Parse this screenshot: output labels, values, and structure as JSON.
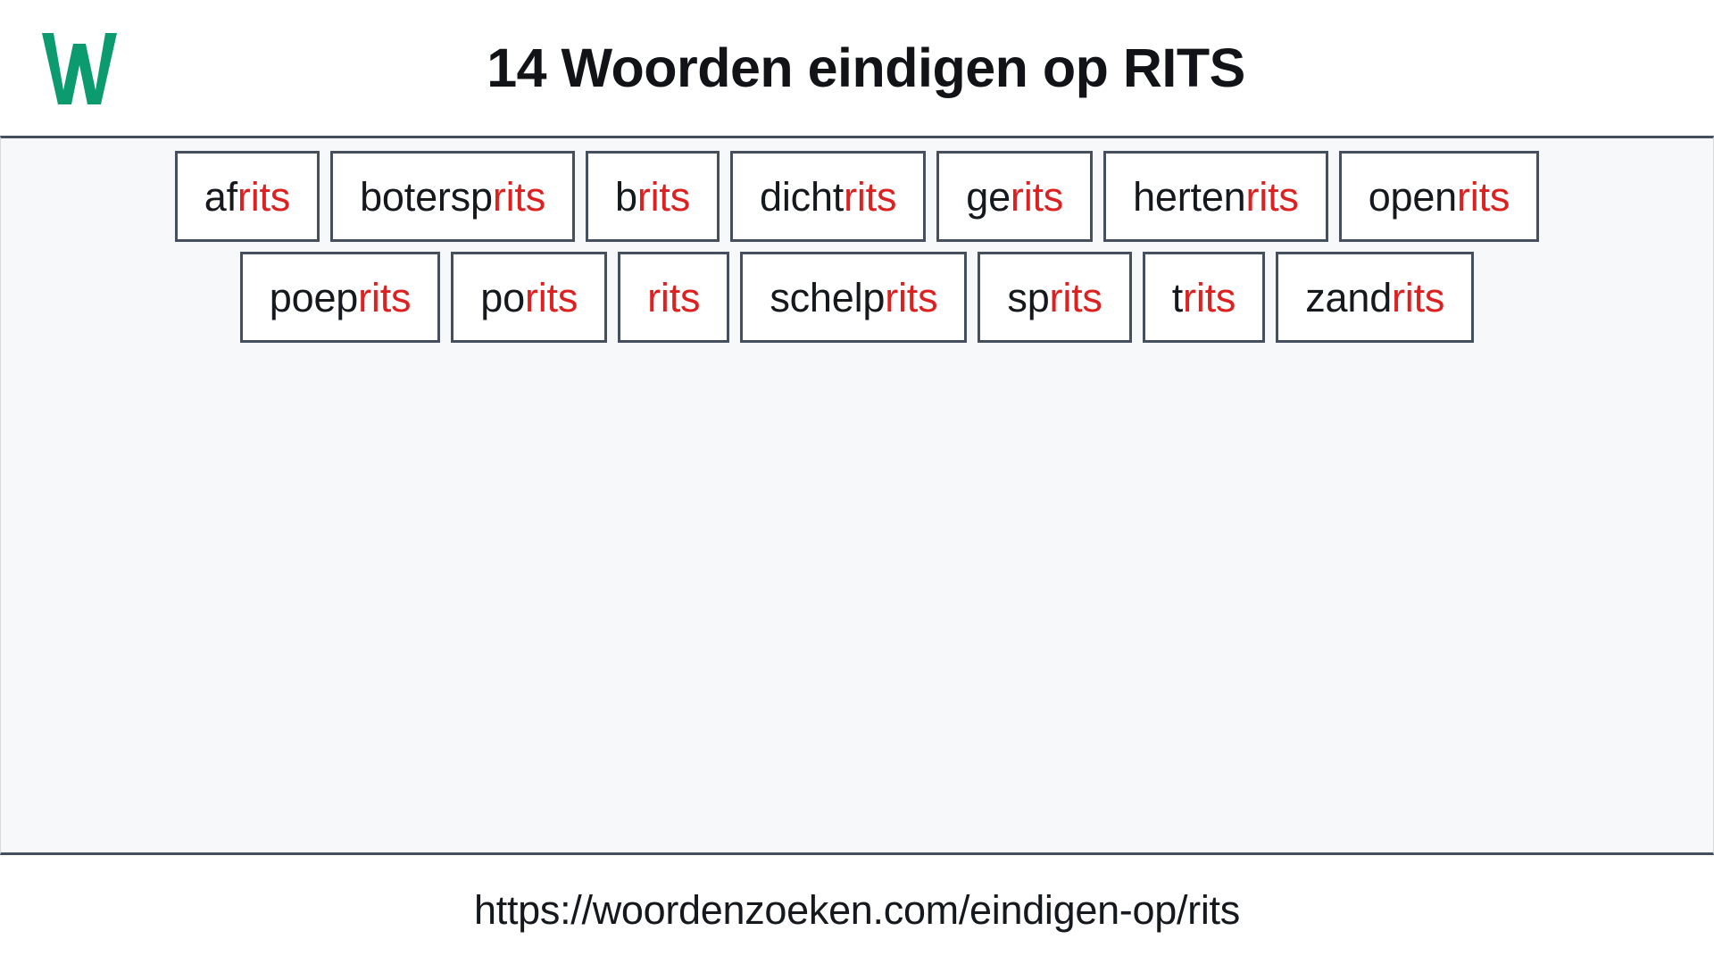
{
  "header": {
    "logo_icon": "letter-w-logo-icon",
    "logo_letter": "W",
    "logo_color": "#0c9b6e",
    "title": "14 Woorden eindigen op RITS"
  },
  "theme": {
    "page_background": "#ffffff",
    "content_background": "#f7f8fa",
    "border_color": "#454f5d",
    "text_color": "#15181c",
    "highlight_color": "#dd2020"
  },
  "main": {
    "highlight_suffix": "rits",
    "word_count": 14,
    "rows": [
      [
        {
          "prefix": "af",
          "suffix": "rits",
          "full": "afrits"
        },
        {
          "prefix": "botersp",
          "suffix": "rits",
          "full": "botersprits"
        },
        {
          "prefix": "b",
          "suffix": "rits",
          "full": "brits"
        },
        {
          "prefix": "dicht",
          "suffix": "rits",
          "full": "dichtrits"
        },
        {
          "prefix": "ge",
          "suffix": "rits",
          "full": "gerits"
        },
        {
          "prefix": "herten",
          "suffix": "rits",
          "full": "hertenrits"
        },
        {
          "prefix": "open",
          "suffix": "rits",
          "full": "openrits"
        }
      ],
      [
        {
          "prefix": "poep",
          "suffix": "rits",
          "full": "poeprits"
        },
        {
          "prefix": "po",
          "suffix": "rits",
          "full": "porits"
        },
        {
          "prefix": "",
          "suffix": "rits",
          "full": "rits"
        },
        {
          "prefix": "schelp",
          "suffix": "rits",
          "full": "schelprits"
        },
        {
          "prefix": "sp",
          "suffix": "rits",
          "full": "sprits"
        },
        {
          "prefix": "t",
          "suffix": "rits",
          "full": "trits"
        },
        {
          "prefix": "zand",
          "suffix": "rits",
          "full": "zandrits"
        }
      ]
    ]
  },
  "footer": {
    "url": "https://woordenzoeken.com/eindigen-op/rits"
  }
}
